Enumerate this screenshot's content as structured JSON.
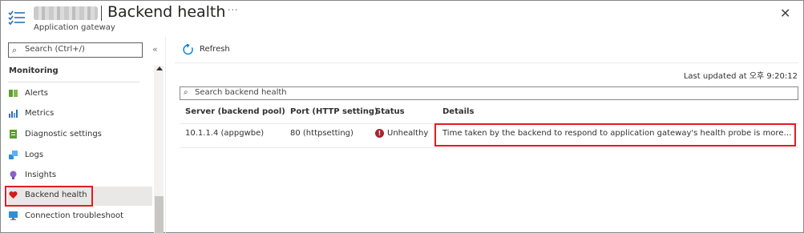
{
  "header": {
    "resource_name_redacted": true,
    "title": "Backend health",
    "more_label": "···",
    "subtitle": "Application gateway",
    "close_label": "✕"
  },
  "sidebar": {
    "search_placeholder": "Search (Ctrl+/)",
    "collapse_label": "«",
    "section_title": "Monitoring",
    "items": [
      {
        "label": "Alerts",
        "icon": "alerts-icon",
        "color": "#5c9e31"
      },
      {
        "label": "Metrics",
        "icon": "metrics-icon",
        "color": "#2f6fb6"
      },
      {
        "label": "Diagnostic settings",
        "icon": "diagnostic-settings-icon",
        "color": "#5c9e31"
      },
      {
        "label": "Logs",
        "icon": "logs-icon",
        "color": "#2f8fd6"
      },
      {
        "label": "Insights",
        "icon": "insights-icon",
        "color": "#8b63c9"
      },
      {
        "label": "Backend health",
        "icon": "heart-icon",
        "color": "#d41c1c",
        "active": true
      },
      {
        "label": "Connection troubleshoot",
        "icon": "connection-troubleshoot-icon",
        "color": "#2f8fd6"
      }
    ]
  },
  "toolbar": {
    "refresh_label": "Refresh"
  },
  "main": {
    "last_updated": "Last updated at 오후 9:20:12",
    "search_placeholder": "Search backend health",
    "columns": [
      "Server (backend pool)",
      "Port (HTTP setting)",
      "Status",
      "Details"
    ],
    "rows": [
      {
        "server": "10.1.1.4 (appgwbe)",
        "port": "80 (httpsetting)",
        "status": "Unhealthy",
        "details": "Time taken by the backend to respond to application gateway's health probe is more than the ..."
      }
    ]
  },
  "colors": {
    "highlight": "#e21d23",
    "error": "#a4262c",
    "accent": "#0078d4"
  }
}
